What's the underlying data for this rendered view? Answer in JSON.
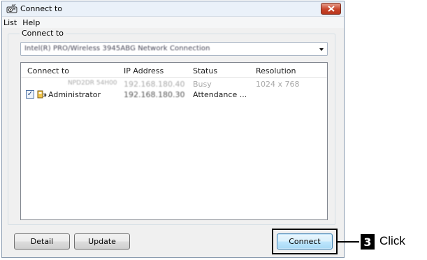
{
  "window": {
    "title": "Connect to",
    "icon": "projector-camera-icon"
  },
  "menu": [
    "List",
    "Help"
  ],
  "group": {
    "legend": "Connect to",
    "adapter": "Intel(R) PRO/Wireless 3945ABG Network Connection"
  },
  "list": {
    "columns": [
      "Connect to",
      "IP Address",
      "Status",
      "Resolution"
    ],
    "rows": [
      {
        "name": "NPD2DR 54H00",
        "ip": "192.168.180.40",
        "status": "Busy",
        "resolution": "1024 x 768",
        "checked": false,
        "icon": ""
      },
      {
        "name": "Administrator",
        "ip": "192.168.180.30",
        "status": "Attendance ...",
        "resolution": "",
        "checked": true,
        "icon": "projector-icon"
      }
    ]
  },
  "buttons": {
    "detail": "Detail",
    "update": "Update",
    "connect": "Connect"
  },
  "callout": {
    "step": "3",
    "text": "Click"
  },
  "colors": {
    "close_button": "#c8442a",
    "default_button_border": "#3c7fb1"
  }
}
